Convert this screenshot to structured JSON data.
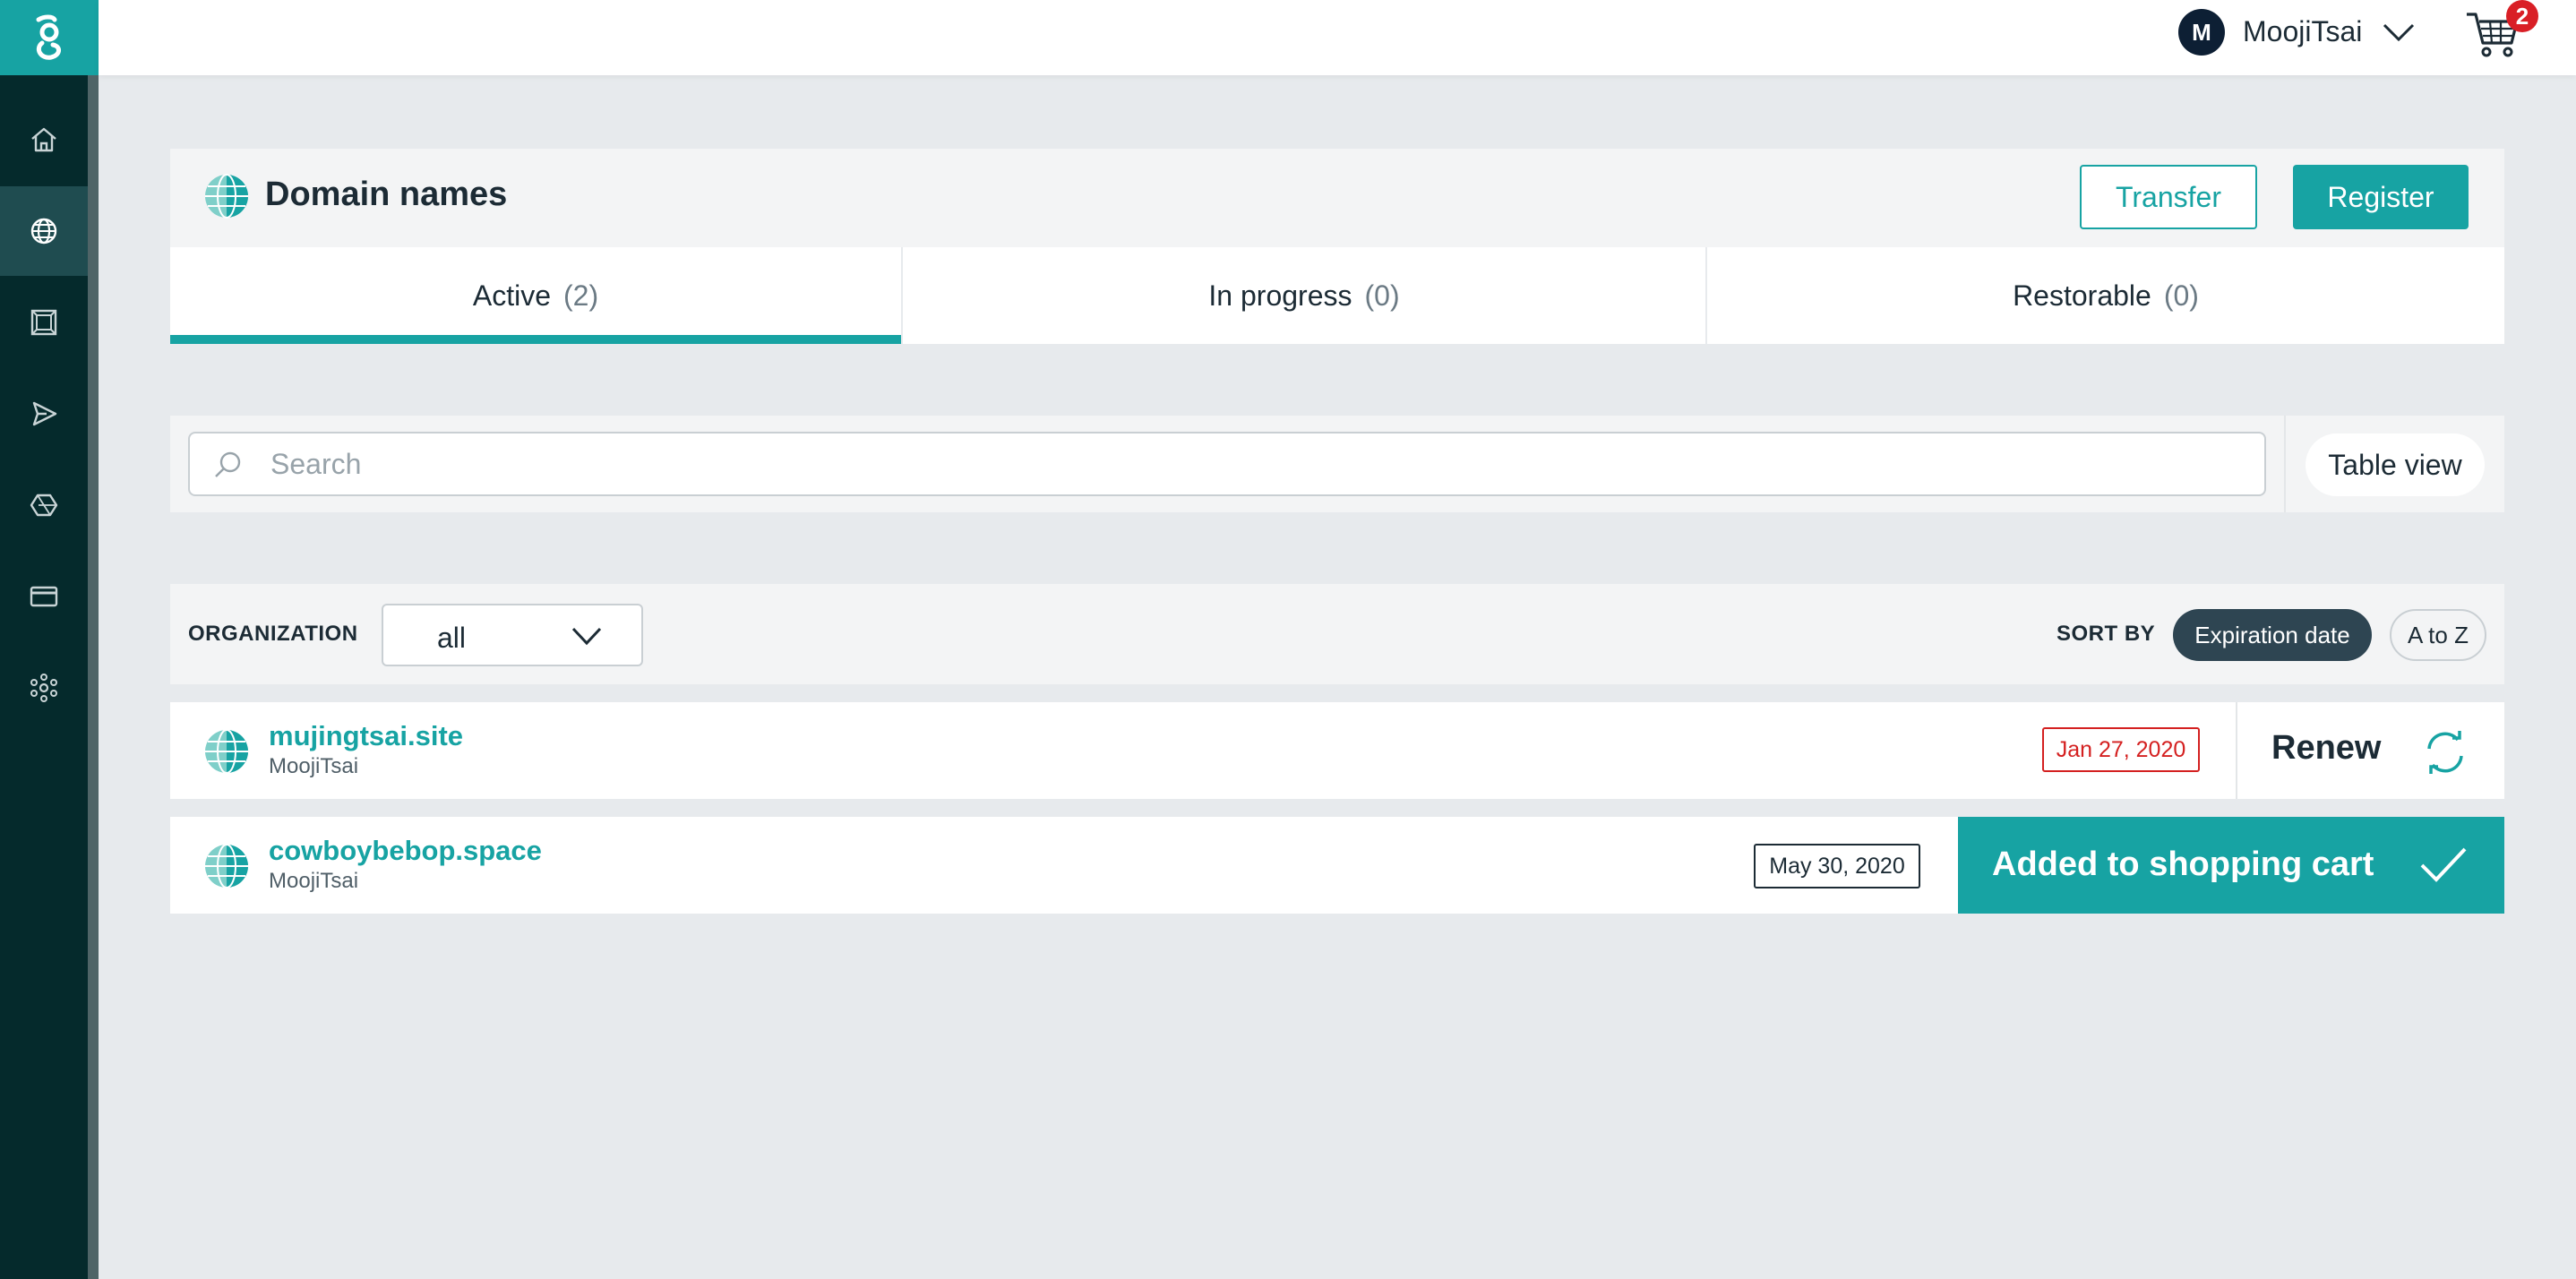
{
  "user": {
    "initial": "M",
    "name": "MoojiTsai"
  },
  "cart": {
    "count": "2"
  },
  "header": {
    "title": "Domain names",
    "transfer_label": "Transfer",
    "register_label": "Register"
  },
  "tabs": [
    {
      "label": "Active",
      "count": "(2)",
      "active": true
    },
    {
      "label": "In progress",
      "count": "(0)",
      "active": false
    },
    {
      "label": "Restorable",
      "count": "(0)",
      "active": false
    }
  ],
  "search": {
    "placeholder": "Search",
    "value": ""
  },
  "view_toggle": {
    "label": "Table view"
  },
  "filter": {
    "organization_label": "ORGANIZATION",
    "organization_value": "all",
    "sort_label": "SORT BY",
    "sort_options": [
      "Expiration date",
      "A to Z"
    ],
    "sort_selected": "Expiration date"
  },
  "domains": [
    {
      "name": "mujingtsai.site",
      "owner": "MoojiTsai",
      "expiration": "Jan 27, 2020",
      "expired": true,
      "action": "Renew"
    },
    {
      "name": "cowboybebop.space",
      "owner": "MoojiTsai",
      "expiration": "May 30, 2020",
      "expired": false,
      "action": "Added to shopping cart"
    }
  ],
  "colors": {
    "brand": "#17a3a3",
    "sidebar": "#052a2c",
    "expired": "#d42020",
    "badge": "#d91f26"
  },
  "icons": {
    "sidebar": [
      "home-icon",
      "globe-icon",
      "frame-icon",
      "send-icon",
      "hexagon-icon",
      "credit-card-icon",
      "network-icon"
    ],
    "header": [
      "user-chevron-icon",
      "cart-icon"
    ]
  }
}
